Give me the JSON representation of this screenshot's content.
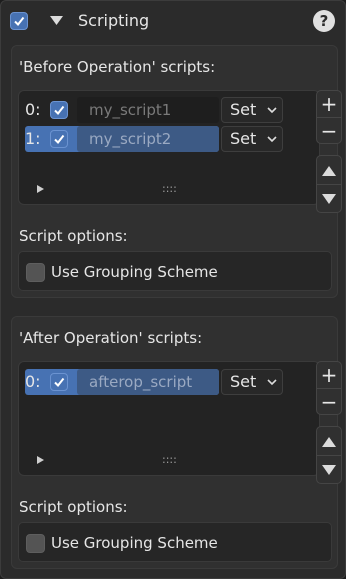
{
  "header": {
    "title": "Scripting",
    "help_glyph": "?",
    "enabled": true
  },
  "before": {
    "label": "'Before Operation' scripts:",
    "rows": [
      {
        "index": "0:",
        "name": "my_script1",
        "mode": "Set",
        "checked": true,
        "selected": false
      },
      {
        "index": "1:",
        "name": "my_script2",
        "mode": "Set",
        "checked": true,
        "selected": true
      }
    ],
    "options_label": "Script options:",
    "grouping_label": "Use Grouping Scheme",
    "grouping_checked": false,
    "grip_glyph": "::::",
    "add_glyph": "+",
    "remove_glyph": "−"
  },
  "after": {
    "label": "'After Operation' scripts:",
    "rows": [
      {
        "index": "0:",
        "name": "afterop_script",
        "mode": "Set",
        "checked": true,
        "selected": true
      }
    ],
    "options_label": "Script options:",
    "grouping_label": "Use Grouping Scheme",
    "grouping_checked": false,
    "grip_glyph": "::::",
    "add_glyph": "+",
    "remove_glyph": "−"
  },
  "colors": {
    "accent": "#4772b3",
    "panel": "#2b2b2b",
    "field": "#1e1e1e"
  }
}
